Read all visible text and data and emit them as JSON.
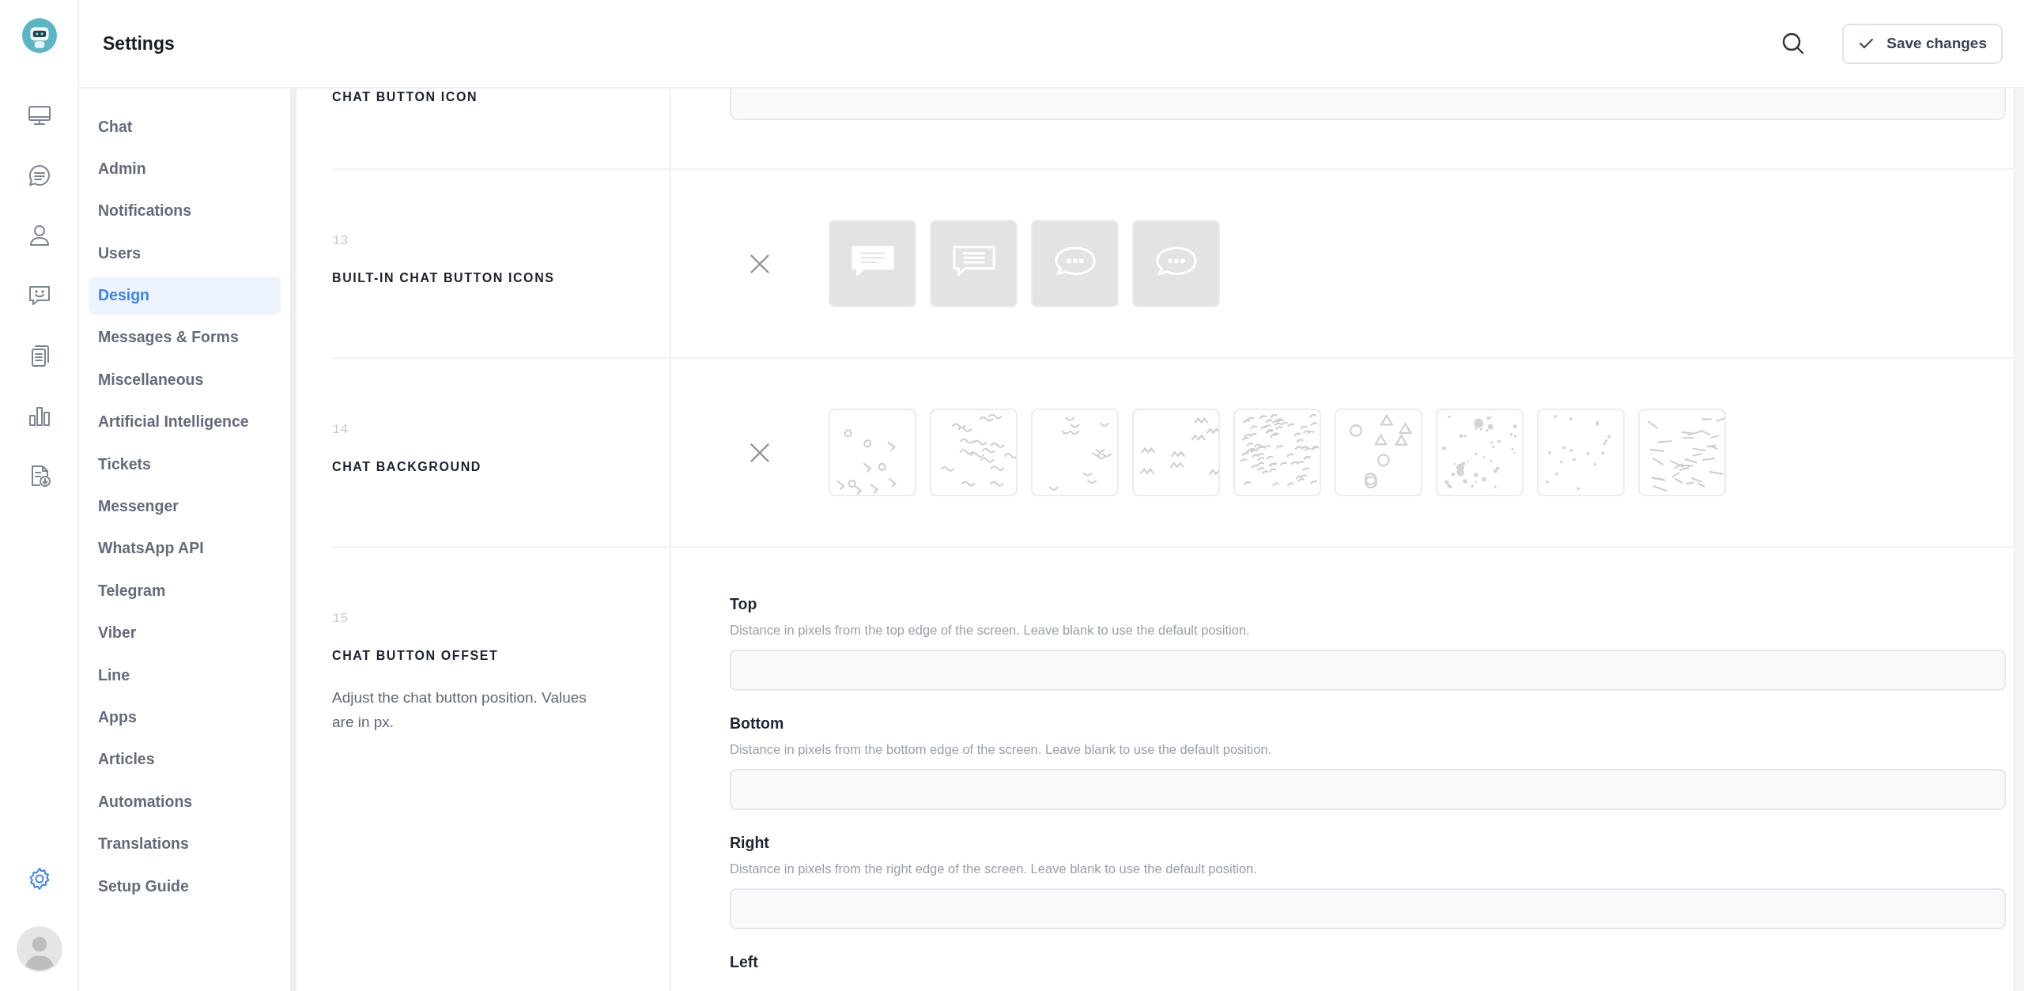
{
  "header": {
    "title": "Settings",
    "save_button": "Save changes"
  },
  "rail": [
    {
      "kind": "monitor",
      "selected": false
    },
    {
      "kind": "chat",
      "selected": false
    },
    {
      "kind": "user",
      "selected": false
    },
    {
      "kind": "smile",
      "selected": false
    },
    {
      "kind": "documents",
      "selected": false
    },
    {
      "kind": "chart",
      "selected": false
    },
    {
      "kind": "download",
      "selected": false
    },
    {
      "kind": "gear",
      "selected": true
    }
  ],
  "sidebar": {
    "items": [
      {
        "label": "Chat",
        "selected": false
      },
      {
        "label": "Admin",
        "selected": false
      },
      {
        "label": "Notifications",
        "selected": false
      },
      {
        "label": "Users",
        "selected": false
      },
      {
        "label": "Design",
        "selected": true
      },
      {
        "label": "Messages & Forms",
        "selected": false
      },
      {
        "label": "Miscellaneous",
        "selected": false
      },
      {
        "label": "Artificial Intelligence",
        "selected": false
      },
      {
        "label": "Tickets",
        "selected": false
      },
      {
        "label": "Messenger",
        "selected": false
      },
      {
        "label": "WhatsApp API",
        "selected": false
      },
      {
        "label": "Telegram",
        "selected": false
      },
      {
        "label": "Viber",
        "selected": false
      },
      {
        "label": "Line",
        "selected": false
      },
      {
        "label": "Apps",
        "selected": false
      },
      {
        "label": "Articles",
        "selected": false
      },
      {
        "label": "Automations",
        "selected": false
      },
      {
        "label": "Translations",
        "selected": false
      },
      {
        "label": "Setup Guide",
        "selected": false
      }
    ]
  },
  "settings": [
    {
      "kind": "partial",
      "title": "CHAT BUTTON ICON"
    },
    {
      "kind": "icons",
      "number": "13",
      "title": "BUILT-IN CHAT BUTTON ICONS",
      "options": [
        {
          "kind": "filled"
        },
        {
          "kind": "outline"
        },
        {
          "kind": "round"
        },
        {
          "kind": "round"
        }
      ]
    },
    {
      "kind": "backgrounds",
      "number": "14",
      "title": "CHAT BACKGROUND",
      "options": [
        {
          "kind": "doodle"
        },
        {
          "kind": "squiggle"
        },
        {
          "kind": "arcs"
        },
        {
          "kind": "zigzag"
        },
        {
          "kind": "dense"
        },
        {
          "kind": "shapes"
        },
        {
          "kind": "bubbles"
        },
        {
          "kind": "sparse"
        },
        {
          "kind": "sticks"
        }
      ]
    },
    {
      "kind": "offsets",
      "number": "15",
      "title": "CHAT BUTTON OFFSET",
      "description": "Adjust the chat button position. Values are in px.",
      "fields": [
        {
          "label": "Top",
          "hint": "Distance in pixels from the top edge of the screen. Leave blank to use the default position."
        },
        {
          "label": "Bottom",
          "hint": "Distance in pixels from the bottom edge of the screen. Leave blank to use the default position."
        },
        {
          "label": "Right",
          "hint": "Distance in pixels from the right edge of the screen. Leave blank to use the default position."
        },
        {
          "label": "Left"
        }
      ]
    }
  ]
}
